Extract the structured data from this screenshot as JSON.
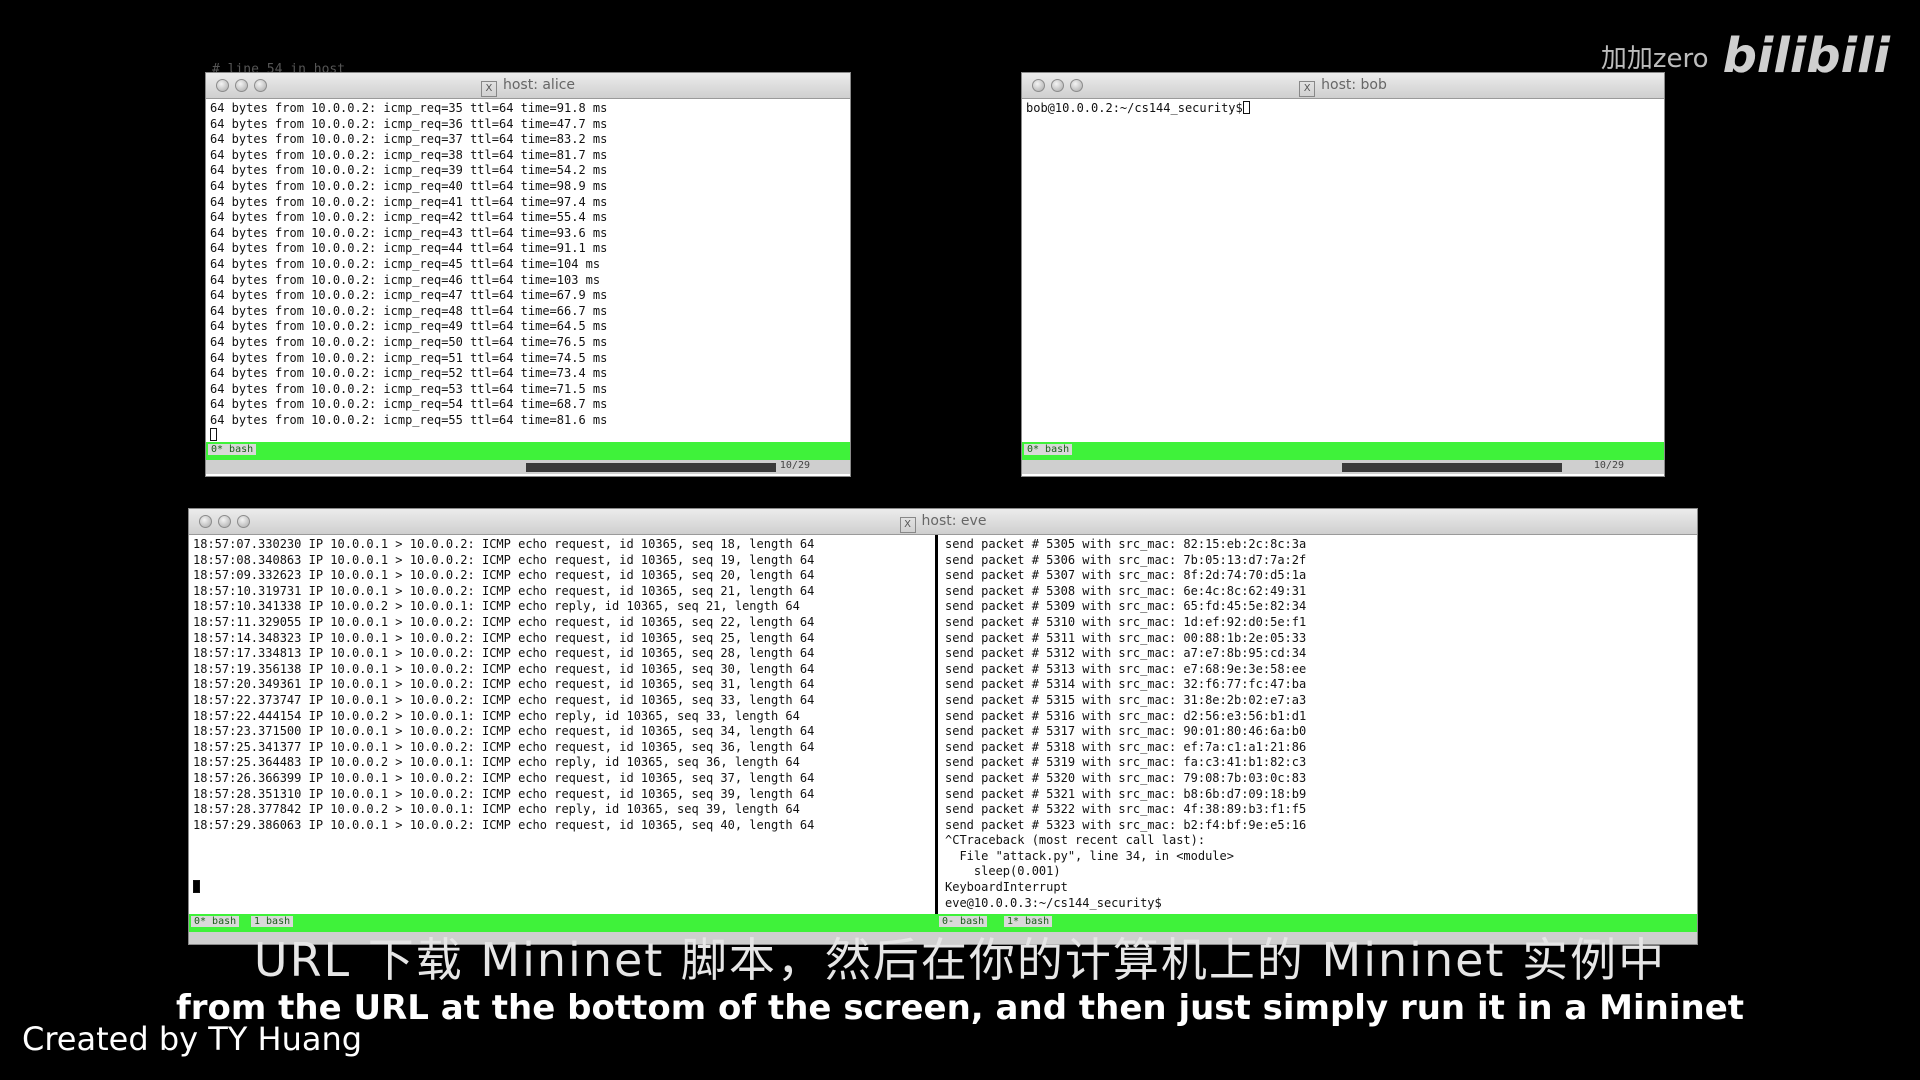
{
  "behind_text": "# line 54 in host",
  "alice": {
    "title": "host: alice",
    "lines": [
      "64 bytes from 10.0.0.2: icmp_req=35 ttl=64 time=91.8 ms",
      "64 bytes from 10.0.0.2: icmp_req=36 ttl=64 time=47.7 ms",
      "64 bytes from 10.0.0.2: icmp_req=37 ttl=64 time=83.2 ms",
      "64 bytes from 10.0.0.2: icmp_req=38 ttl=64 time=81.7 ms",
      "64 bytes from 10.0.0.2: icmp_req=39 ttl=64 time=54.2 ms",
      "64 bytes from 10.0.0.2: icmp_req=40 ttl=64 time=98.9 ms",
      "64 bytes from 10.0.0.2: icmp_req=41 ttl=64 time=97.4 ms",
      "64 bytes from 10.0.0.2: icmp_req=42 ttl=64 time=55.4 ms",
      "64 bytes from 10.0.0.2: icmp_req=43 ttl=64 time=93.6 ms",
      "64 bytes from 10.0.0.2: icmp_req=44 ttl=64 time=91.1 ms",
      "64 bytes from 10.0.0.2: icmp_req=45 ttl=64 time=104 ms",
      "64 bytes from 10.0.0.2: icmp_req=46 ttl=64 time=103 ms",
      "64 bytes from 10.0.0.2: icmp_req=47 ttl=64 time=67.9 ms",
      "64 bytes from 10.0.0.2: icmp_req=48 ttl=64 time=66.7 ms",
      "64 bytes from 10.0.0.2: icmp_req=49 ttl=64 time=64.5 ms",
      "64 bytes from 10.0.0.2: icmp_req=50 ttl=64 time=76.5 ms",
      "64 bytes from 10.0.0.2: icmp_req=51 ttl=64 time=74.5 ms",
      "64 bytes from 10.0.0.2: icmp_req=52 ttl=64 time=73.4 ms",
      "64 bytes from 10.0.0.2: icmp_req=53 ttl=64 time=71.5 ms",
      "64 bytes from 10.0.0.2: icmp_req=54 ttl=64 time=68.7 ms",
      "64 bytes from 10.0.0.2: icmp_req=55 ttl=64 time=81.6 ms"
    ],
    "status_label": "0* bash",
    "status_right": "10/29"
  },
  "bob": {
    "title": "host: bob",
    "prompt": "bob@10.0.0.2:~/cs144_security$",
    "status_label": "0* bash",
    "status_right": "10/29"
  },
  "eve": {
    "title": "host: eve",
    "left_lines": [
      "18:57:07.330230 IP 10.0.0.1 > 10.0.0.2: ICMP echo request, id 10365, seq 18, length 64",
      "18:57:08.340863 IP 10.0.0.1 > 10.0.0.2: ICMP echo request, id 10365, seq 19, length 64",
      "18:57:09.332623 IP 10.0.0.1 > 10.0.0.2: ICMP echo request, id 10365, seq 20, length 64",
      "18:57:10.319731 IP 10.0.0.1 > 10.0.0.2: ICMP echo request, id 10365, seq 21, length 64",
      "18:57:10.341338 IP 10.0.0.2 > 10.0.0.1: ICMP echo reply, id 10365, seq 21, length 64",
      "18:57:11.329055 IP 10.0.0.1 > 10.0.0.2: ICMP echo request, id 10365, seq 22, length 64",
      "18:57:14.348323 IP 10.0.0.1 > 10.0.0.2: ICMP echo request, id 10365, seq 25, length 64",
      "18:57:17.334813 IP 10.0.0.1 > 10.0.0.2: ICMP echo request, id 10365, seq 28, length 64",
      "18:57:19.356138 IP 10.0.0.1 > 10.0.0.2: ICMP echo request, id 10365, seq 30, length 64",
      "18:57:20.349361 IP 10.0.0.1 > 10.0.0.2: ICMP echo request, id 10365, seq 31, length 64",
      "18:57:22.373747 IP 10.0.0.1 > 10.0.0.2: ICMP echo request, id 10365, seq 33, length 64",
      "18:57:22.444154 IP 10.0.0.2 > 10.0.0.1: ICMP echo reply, id 10365, seq 33, length 64",
      "18:57:23.371500 IP 10.0.0.1 > 10.0.0.2: ICMP echo request, id 10365, seq 34, length 64",
      "18:57:25.341377 IP 10.0.0.1 > 10.0.0.2: ICMP echo request, id 10365, seq 36, length 64",
      "18:57:25.364483 IP 10.0.0.2 > 10.0.0.1: ICMP echo reply, id 10365, seq 36, length 64",
      "18:57:26.366399 IP 10.0.0.1 > 10.0.0.2: ICMP echo request, id 10365, seq 37, length 64",
      "18:57:28.351310 IP 10.0.0.1 > 10.0.0.2: ICMP echo request, id 10365, seq 39, length 64",
      "18:57:28.377842 IP 10.0.0.2 > 10.0.0.1: ICMP echo reply, id 10365, seq 39, length 64",
      "18:57:29.386063 IP 10.0.0.1 > 10.0.0.2: ICMP echo request, id 10365, seq 40, length 64"
    ],
    "right_lines": [
      "send packet # 5305 with src_mac: 82:15:eb:2c:8c:3a",
      "send packet # 5306 with src_mac: 7b:05:13:d7:7a:2f",
      "send packet # 5307 with src_mac: 8f:2d:74:70:d5:1a",
      "send packet # 5308 with src_mac: 6e:4c:8c:62:49:31",
      "send packet # 5309 with src_mac: 65:fd:45:5e:82:34",
      "send packet # 5310 with src_mac: 1d:ef:92:d0:5e:f1",
      "send packet # 5311 with src_mac: 00:88:1b:2e:05:33",
      "send packet # 5312 with src_mac: a7:e7:8b:95:cd:34",
      "send packet # 5313 with src_mac: e7:68:9e:3e:58:ee",
      "send packet # 5314 with src_mac: 32:f6:77:fc:47:ba",
      "send packet # 5315 with src_mac: 31:8e:2b:02:e7:a3",
      "send packet # 5316 with src_mac: d2:56:e3:56:b1:d1",
      "send packet # 5317 with src_mac: 90:01:80:46:6a:b0",
      "send packet # 5318 with src_mac: ef:7a:c1:a1:21:86",
      "send packet # 5319 with src_mac: fa:c3:41:b1:82:c3",
      "send packet # 5320 with src_mac: 79:08:7b:03:0c:83",
      "send packet # 5321 with src_mac: b8:6b:d7:09:18:b9",
      "send packet # 5322 with src_mac: 4f:38:89:b3:f1:f5",
      "send packet # 5323 with src_mac: b2:f4:bf:9e:e5:16",
      "^CTraceback (most recent call last):",
      "  File \"attack.py\", line 34, in <module>",
      "    sleep(0.001)",
      "KeyboardInterrupt",
      "eve@10.0.0.3:~/cs144_security$"
    ],
    "status_left": "0* bash",
    "status_mid": "1 bash",
    "status_right_a": "0- bash",
    "status_right_b": "1* bash"
  },
  "subtitle_cn": "URL 下载 Mininet 脚本，然后在你的计算机上的 Mininet 实例中",
  "subtitle_en": "from the URL at the bottom of the screen, and then just simply run it in a Mininet",
  "credit": "Created by TY Huang",
  "watermark": {
    "user": "加加zero",
    "logo": "bilibili"
  }
}
